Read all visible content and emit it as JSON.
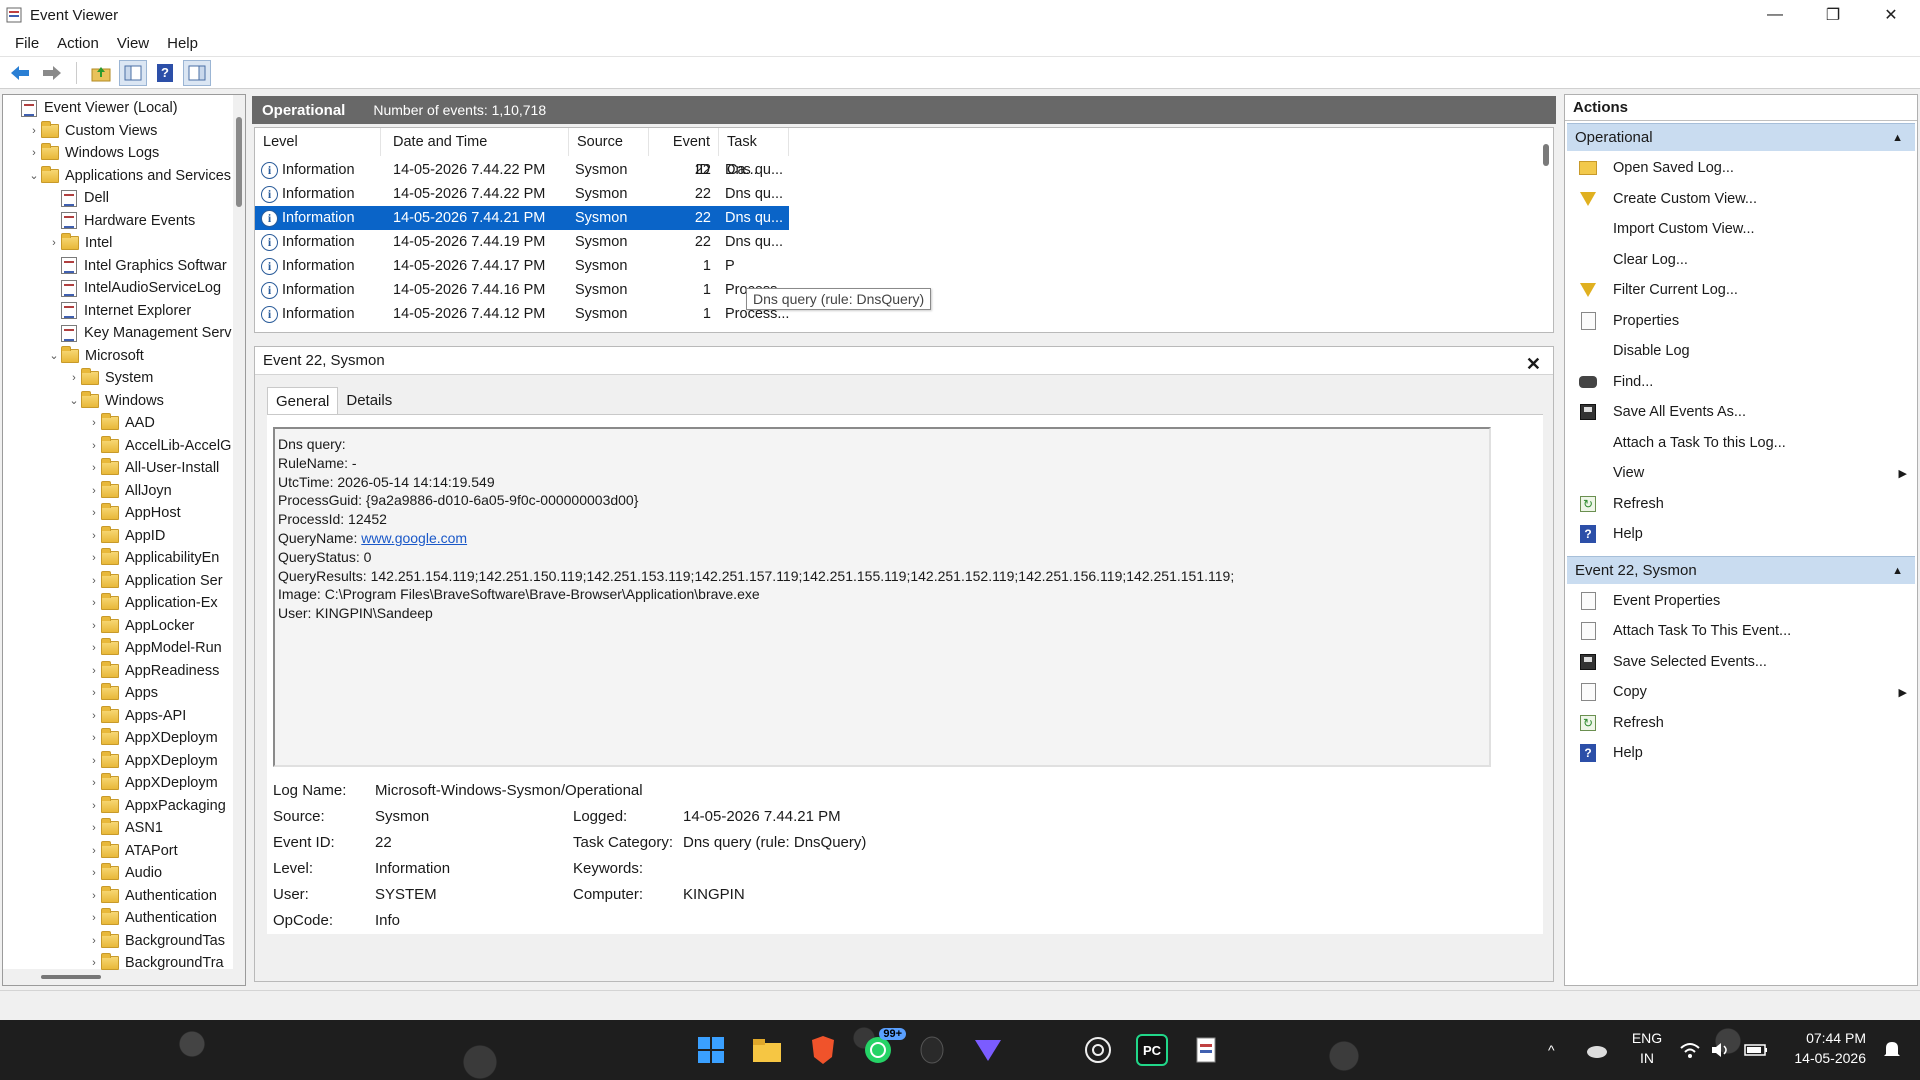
{
  "window": {
    "title": "Event Viewer",
    "controls": {
      "minimize": "—",
      "restore": "❐",
      "close": "✕"
    }
  },
  "menu": [
    "File",
    "Action",
    "View",
    "Help"
  ],
  "toolbar": [
    "back-icon",
    "forward-icon",
    "up-folder-icon",
    "show-hide-tree-icon",
    "help-icon",
    "show-hide-action-pane-icon"
  ],
  "tree": {
    "items": [
      {
        "label": "Event Viewer (Local)",
        "depth": 0,
        "icon": "log",
        "chev": ""
      },
      {
        "label": "Custom Views",
        "depth": 1,
        "icon": "folder",
        "chev": ">"
      },
      {
        "label": "Windows Logs",
        "depth": 1,
        "icon": "folder",
        "chev": ">"
      },
      {
        "label": "Applications and Services",
        "depth": 1,
        "icon": "folder",
        "chev": "v"
      },
      {
        "label": "Dell",
        "depth": 2,
        "icon": "log",
        "chev": ""
      },
      {
        "label": "Hardware Events",
        "depth": 2,
        "icon": "log",
        "chev": ""
      },
      {
        "label": "Intel",
        "depth": 2,
        "icon": "folder",
        "chev": ">"
      },
      {
        "label": "Intel Graphics Softwar",
        "depth": 2,
        "icon": "log",
        "chev": ""
      },
      {
        "label": "IntelAudioServiceLog",
        "depth": 2,
        "icon": "log",
        "chev": ""
      },
      {
        "label": "Internet Explorer",
        "depth": 2,
        "icon": "log",
        "chev": ""
      },
      {
        "label": "Key Management Serv",
        "depth": 2,
        "icon": "log",
        "chev": ""
      },
      {
        "label": "Microsoft",
        "depth": 2,
        "icon": "folder",
        "chev": "v"
      },
      {
        "label": "System",
        "depth": 3,
        "icon": "folder",
        "chev": ">"
      },
      {
        "label": "Windows",
        "depth": 3,
        "icon": "folder",
        "chev": "v"
      },
      {
        "label": "AAD",
        "depth": 4,
        "icon": "folder",
        "chev": ">"
      },
      {
        "label": "AccelLib-AccelG",
        "depth": 4,
        "icon": "folder",
        "chev": ">"
      },
      {
        "label": "All-User-Install",
        "depth": 4,
        "icon": "folder",
        "chev": ">"
      },
      {
        "label": "AllJoyn",
        "depth": 4,
        "icon": "folder",
        "chev": ">"
      },
      {
        "label": "AppHost",
        "depth": 4,
        "icon": "folder",
        "chev": ">"
      },
      {
        "label": "AppID",
        "depth": 4,
        "icon": "folder",
        "chev": ">"
      },
      {
        "label": "ApplicabilityEn",
        "depth": 4,
        "icon": "folder",
        "chev": ">"
      },
      {
        "label": "Application Ser",
        "depth": 4,
        "icon": "folder",
        "chev": ">"
      },
      {
        "label": "Application-Ex",
        "depth": 4,
        "icon": "folder",
        "chev": ">"
      },
      {
        "label": "AppLocker",
        "depth": 4,
        "icon": "folder",
        "chev": ">"
      },
      {
        "label": "AppModel-Run",
        "depth": 4,
        "icon": "folder",
        "chev": ">"
      },
      {
        "label": "AppReadiness",
        "depth": 4,
        "icon": "folder",
        "chev": ">"
      },
      {
        "label": "Apps",
        "depth": 4,
        "icon": "folder",
        "chev": ">"
      },
      {
        "label": "Apps-API",
        "depth": 4,
        "icon": "folder",
        "chev": ">"
      },
      {
        "label": "AppXDeploym",
        "depth": 4,
        "icon": "folder",
        "chev": ">"
      },
      {
        "label": "AppXDeploym",
        "depth": 4,
        "icon": "folder",
        "chev": ">"
      },
      {
        "label": "AppXDeploym",
        "depth": 4,
        "icon": "folder",
        "chev": ">"
      },
      {
        "label": "AppxPackaging",
        "depth": 4,
        "icon": "folder",
        "chev": ">"
      },
      {
        "label": "ASN1",
        "depth": 4,
        "icon": "folder",
        "chev": ">"
      },
      {
        "label": "ATAPort",
        "depth": 4,
        "icon": "folder",
        "chev": ">"
      },
      {
        "label": "Audio",
        "depth": 4,
        "icon": "folder",
        "chev": ">"
      },
      {
        "label": "Authentication",
        "depth": 4,
        "icon": "folder",
        "chev": ">"
      },
      {
        "label": "Authentication",
        "depth": 4,
        "icon": "folder",
        "chev": ">"
      },
      {
        "label": "BackgroundTas",
        "depth": 4,
        "icon": "folder",
        "chev": ">"
      },
      {
        "label": "BackgroundTra",
        "depth": 4,
        "icon": "folder",
        "chev": ">"
      }
    ]
  },
  "events_panel": {
    "name": "Operational",
    "count_text": "Number of events: 1,10,718",
    "columns": [
      "Level",
      "Date and Time",
      "Source",
      "Event ID",
      "Task Ca..."
    ],
    "rows": [
      {
        "level": "Information",
        "date": "14-05-2026 7.44.22 PM",
        "source": "Sysmon",
        "id": "22",
        "task": "Dns qu...",
        "selected": false
      },
      {
        "level": "Information",
        "date": "14-05-2026 7.44.22 PM",
        "source": "Sysmon",
        "id": "22",
        "task": "Dns qu...",
        "selected": false
      },
      {
        "level": "Information",
        "date": "14-05-2026 7.44.21 PM",
        "source": "Sysmon",
        "id": "22",
        "task": "Dns qu...",
        "selected": true
      },
      {
        "level": "Information",
        "date": "14-05-2026 7.44.19 PM",
        "source": "Sysmon",
        "id": "22",
        "task": "Dns qu...",
        "selected": false
      },
      {
        "level": "Information",
        "date": "14-05-2026 7.44.17 PM",
        "source": "Sysmon",
        "id": "1",
        "task": "P",
        "selected": false
      },
      {
        "level": "Information",
        "date": "14-05-2026 7.44.16 PM",
        "source": "Sysmon",
        "id": "1",
        "task": "Process...",
        "selected": false
      },
      {
        "level": "Information",
        "date": "14-05-2026 7.44.12 PM",
        "source": "Sysmon",
        "id": "1",
        "task": "Process...",
        "selected": false
      }
    ],
    "tooltip": "Dns query (rule: DnsQuery)"
  },
  "detail": {
    "title": "Event 22, Sysmon",
    "tabs": [
      "General",
      "Details"
    ],
    "message_lines": [
      "Dns query:",
      "RuleName: -",
      "UtcTime: 2026-05-14 14:14:19.549",
      "ProcessGuid: {9a2a9886-d010-6a05-9f0c-000000003d00}",
      "ProcessId: 12452"
    ],
    "query_name_label": "QueryName: ",
    "query_name_link": "www.google.com",
    "message_lines_after": [
      "QueryStatus: 0",
      "QueryResults: 142.251.154.119;142.251.150.119;142.251.153.119;142.251.157.119;142.251.155.119;142.251.152.119;142.251.156.119;142.251.151.119;",
      "Image: C:\\Program Files\\BraveSoftware\\Brave-Browser\\Application\\brave.exe",
      "User: KINGPIN\\Sandeep"
    ],
    "properties": {
      "log_name_label": "Log Name:",
      "log_name": "Microsoft-Windows-Sysmon/Operational",
      "source_label": "Source:",
      "source": "Sysmon",
      "logged_label": "Logged:",
      "logged": "14-05-2026 7.44.21 PM",
      "event_id_label": "Event ID:",
      "event_id": "22",
      "task_category_label": "Task Category:",
      "task_category": "Dns query (rule: DnsQuery)",
      "level_label": "Level:",
      "level": "Information",
      "keywords_label": "Keywords:",
      "keywords": "",
      "user_label": "User:",
      "user": "SYSTEM",
      "computer_label": "Computer:",
      "computer": "KINGPIN",
      "opcode_label": "OpCode:",
      "opcode": "Info"
    }
  },
  "actions": {
    "title": "Actions",
    "group1": "Operational",
    "group1_items": [
      {
        "label": "Open Saved Log...",
        "icon": "folder-open-icon",
        "submenu": false
      },
      {
        "label": "Create Custom View...",
        "icon": "funnel-icon",
        "submenu": false
      },
      {
        "label": "Import Custom View...",
        "icon": "",
        "submenu": false
      },
      {
        "label": "Clear Log...",
        "icon": "",
        "submenu": false
      },
      {
        "label": "Filter Current Log...",
        "icon": "funnel-icon",
        "submenu": false
      },
      {
        "label": "Properties",
        "icon": "properties-icon",
        "submenu": false
      },
      {
        "label": "Disable Log",
        "icon": "",
        "submenu": false
      },
      {
        "label": "Find...",
        "icon": "binoculars-icon",
        "submenu": false
      },
      {
        "label": "Save All Events As...",
        "icon": "save-icon",
        "submenu": false
      },
      {
        "label": "Attach a Task To this Log...",
        "icon": "",
        "submenu": false
      },
      {
        "label": "View",
        "icon": "",
        "submenu": true
      },
      {
        "label": "Refresh",
        "icon": "refresh-icon",
        "submenu": false
      },
      {
        "label": "Help",
        "icon": "help-icon",
        "submenu": false
      }
    ],
    "group2": "Event 22, Sysmon",
    "group2_items": [
      {
        "label": "Event Properties",
        "icon": "properties-icon",
        "submenu": false
      },
      {
        "label": "Attach Task To This Event...",
        "icon": "task-icon",
        "submenu": false
      },
      {
        "label": "Save Selected Events...",
        "icon": "save-icon",
        "submenu": false
      },
      {
        "label": "Copy",
        "icon": "copy-icon",
        "submenu": true
      },
      {
        "label": "Refresh",
        "icon": "refresh-icon",
        "submenu": false
      },
      {
        "label": "Help",
        "icon": "help-icon",
        "submenu": false
      }
    ]
  },
  "taskbar": {
    "apps": [
      "windows-start-icon",
      "file-explorer-icon",
      "brave-browser-icon",
      "whatsapp-icon",
      "app-icon",
      "proton-vpn-icon",
      "chatgpt-icon",
      "pycharm-icon",
      "event-viewer-icon"
    ],
    "whatsapp_badge": "99+",
    "tray_chevron": "^",
    "lang_top": "ENG",
    "lang_bottom": "IN",
    "time": "07:44 PM",
    "date": "14-05-2026"
  },
  "colors": {
    "selection": "#0a64c8",
    "header_bg": "#686868",
    "actions_group_bg": "#c9dcf0",
    "link": "#1a58c8"
  }
}
